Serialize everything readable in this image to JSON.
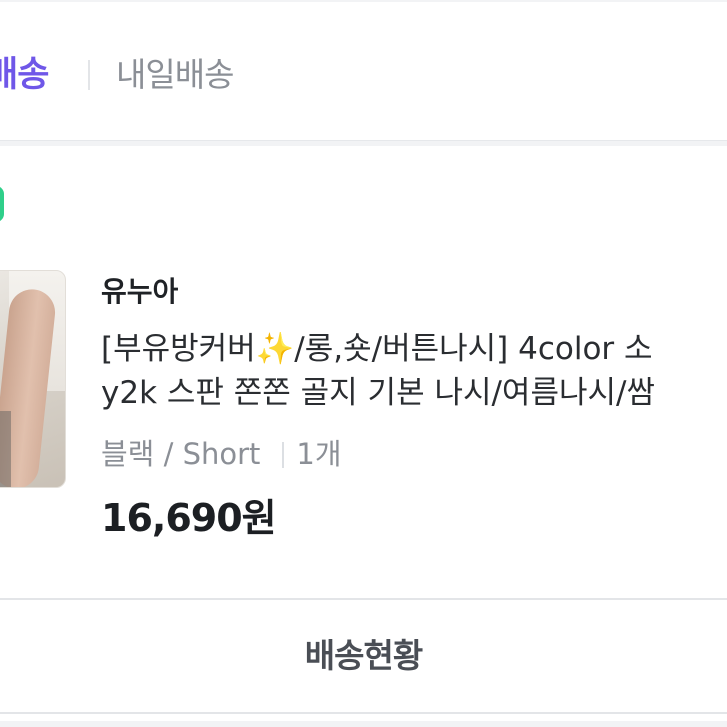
{
  "delivery_tabs": {
    "active_label": "배송",
    "inactive_label": "내일배송"
  },
  "order": {
    "seller": "유누아",
    "product_title_line1": "[부유방커버✨/롱,숏/버튼나시] 4color 소",
    "product_title_line2": "y2k 스판 쫀쫀 골지 기본 나시/여름나시/쌈",
    "option": "블랙 / Short",
    "quantity": "1개",
    "price": "16,690원",
    "track_button_label": "배송현황"
  },
  "colors": {
    "accent": "#6f57e8",
    "status": "#2fcf8a"
  },
  "icons": {
    "status": "status-dot-icon"
  }
}
